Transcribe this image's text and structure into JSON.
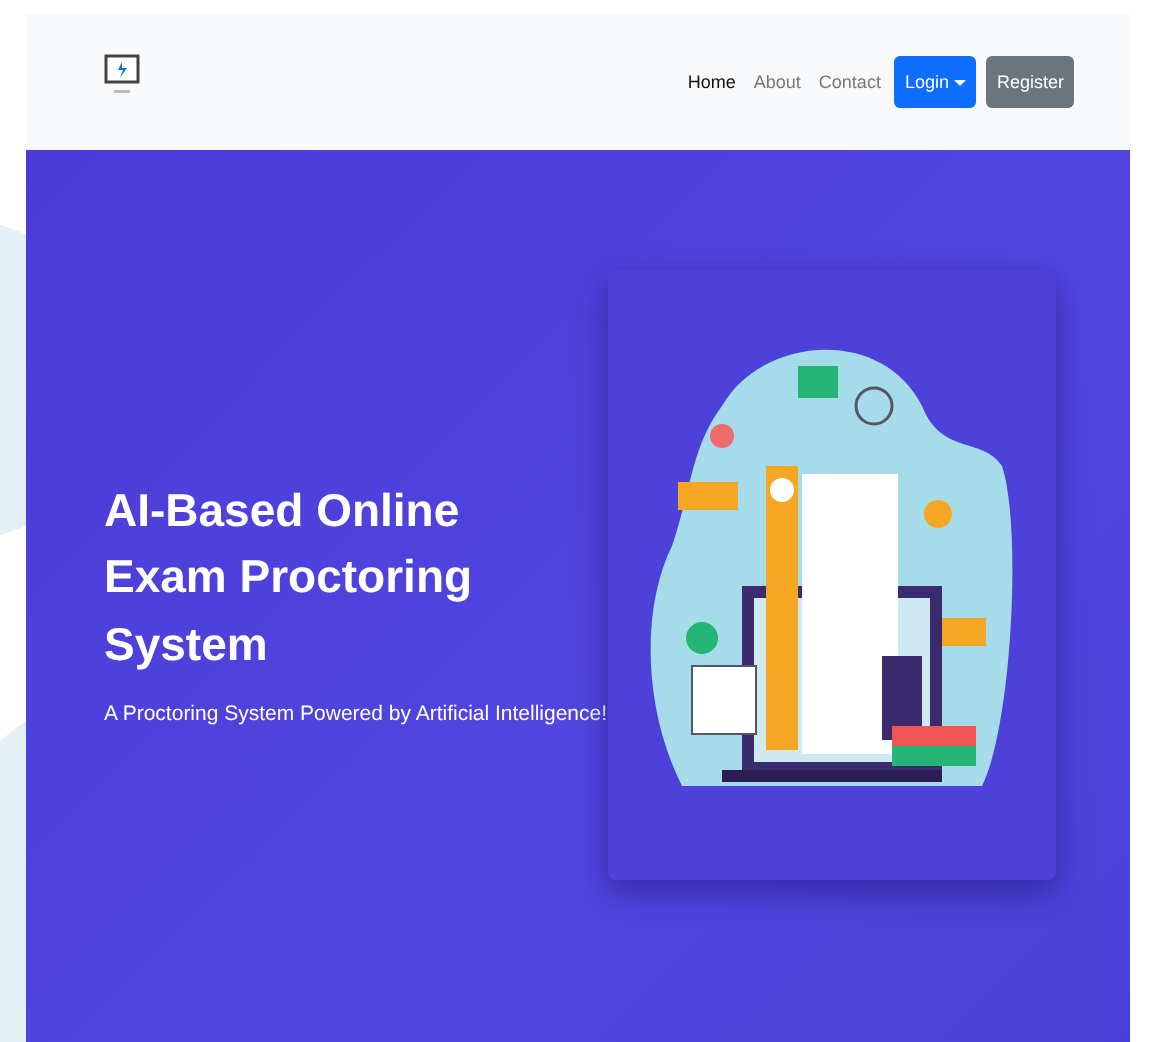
{
  "navbar": {
    "links": [
      {
        "label": "Home",
        "selected": true
      },
      {
        "label": "About",
        "selected": false
      },
      {
        "label": "Contact",
        "selected": false
      }
    ],
    "buttons": [
      {
        "label": "Login",
        "kind": "dropdown"
      },
      {
        "label": "Register",
        "kind": "plain"
      }
    ]
  },
  "hero": {
    "title": "AI-Based Online Exam Proctoring System",
    "subtitle": "A Proctoring System Powered by Artificial Intelligence!"
  }
}
